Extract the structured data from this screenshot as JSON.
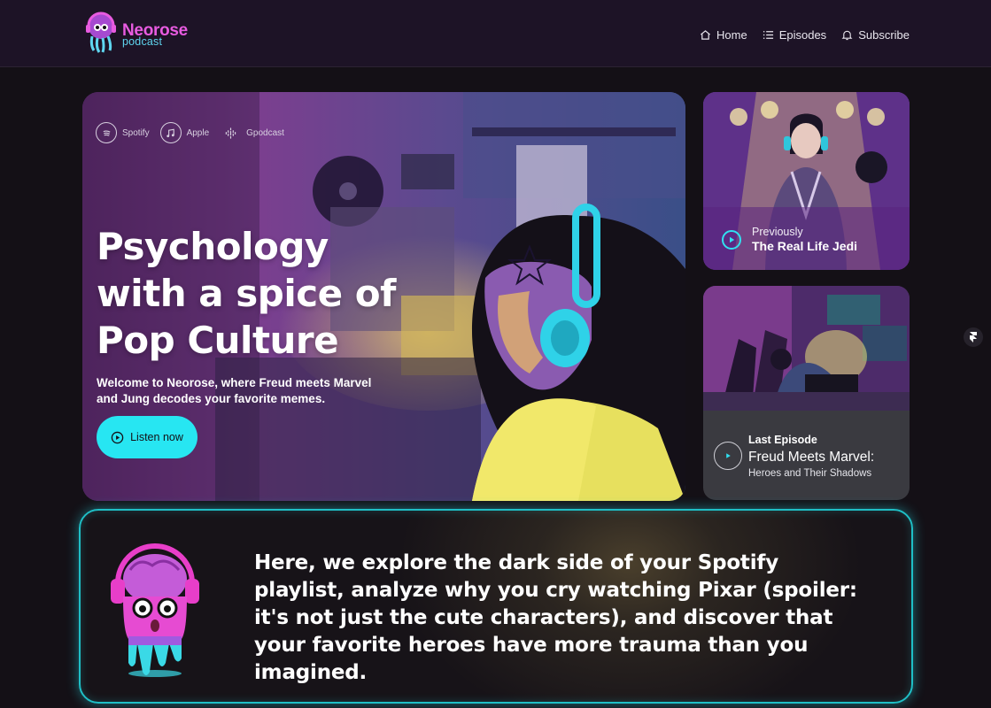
{
  "brand": {
    "name": "Neorose",
    "sub": "podcast"
  },
  "nav": [
    {
      "label": "Home",
      "icon": "home-icon"
    },
    {
      "label": "Episodes",
      "icon": "list-icon"
    },
    {
      "label": "Subscribe",
      "icon": "bell-icon"
    }
  ],
  "hero": {
    "platforms": [
      {
        "label": "Spotify",
        "icon": "spotify-icon"
      },
      {
        "label": "Apple",
        "icon": "music-note-icon"
      },
      {
        "label": "Gpodcast",
        "icon": "google-podcast-icon"
      }
    ],
    "title": "Psychology with a spice of Pop Culture",
    "description": "Welcome to Neorose, where Freud meets Marvel and Jung decodes your favorite memes.",
    "cta": "Listen now"
  },
  "previous": {
    "label": "Previously",
    "title": "The Real Life Jedi"
  },
  "last": {
    "label": "Last Episode",
    "title": "Freud Meets Marvel:",
    "subtitle": "Heroes and Their Shadows"
  },
  "about": {
    "text": "Here, we explore the dark side of your Spotify playlist, analyze why you cry watching Pixar (spoiler: it's not just the cute characters), and discover that your favorite heroes have more trauma than you imagined."
  },
  "colors": {
    "accent": "#27e6f2",
    "brand": "#e85be0",
    "header_bg": "#1d1326",
    "page_bg": "#141016"
  }
}
